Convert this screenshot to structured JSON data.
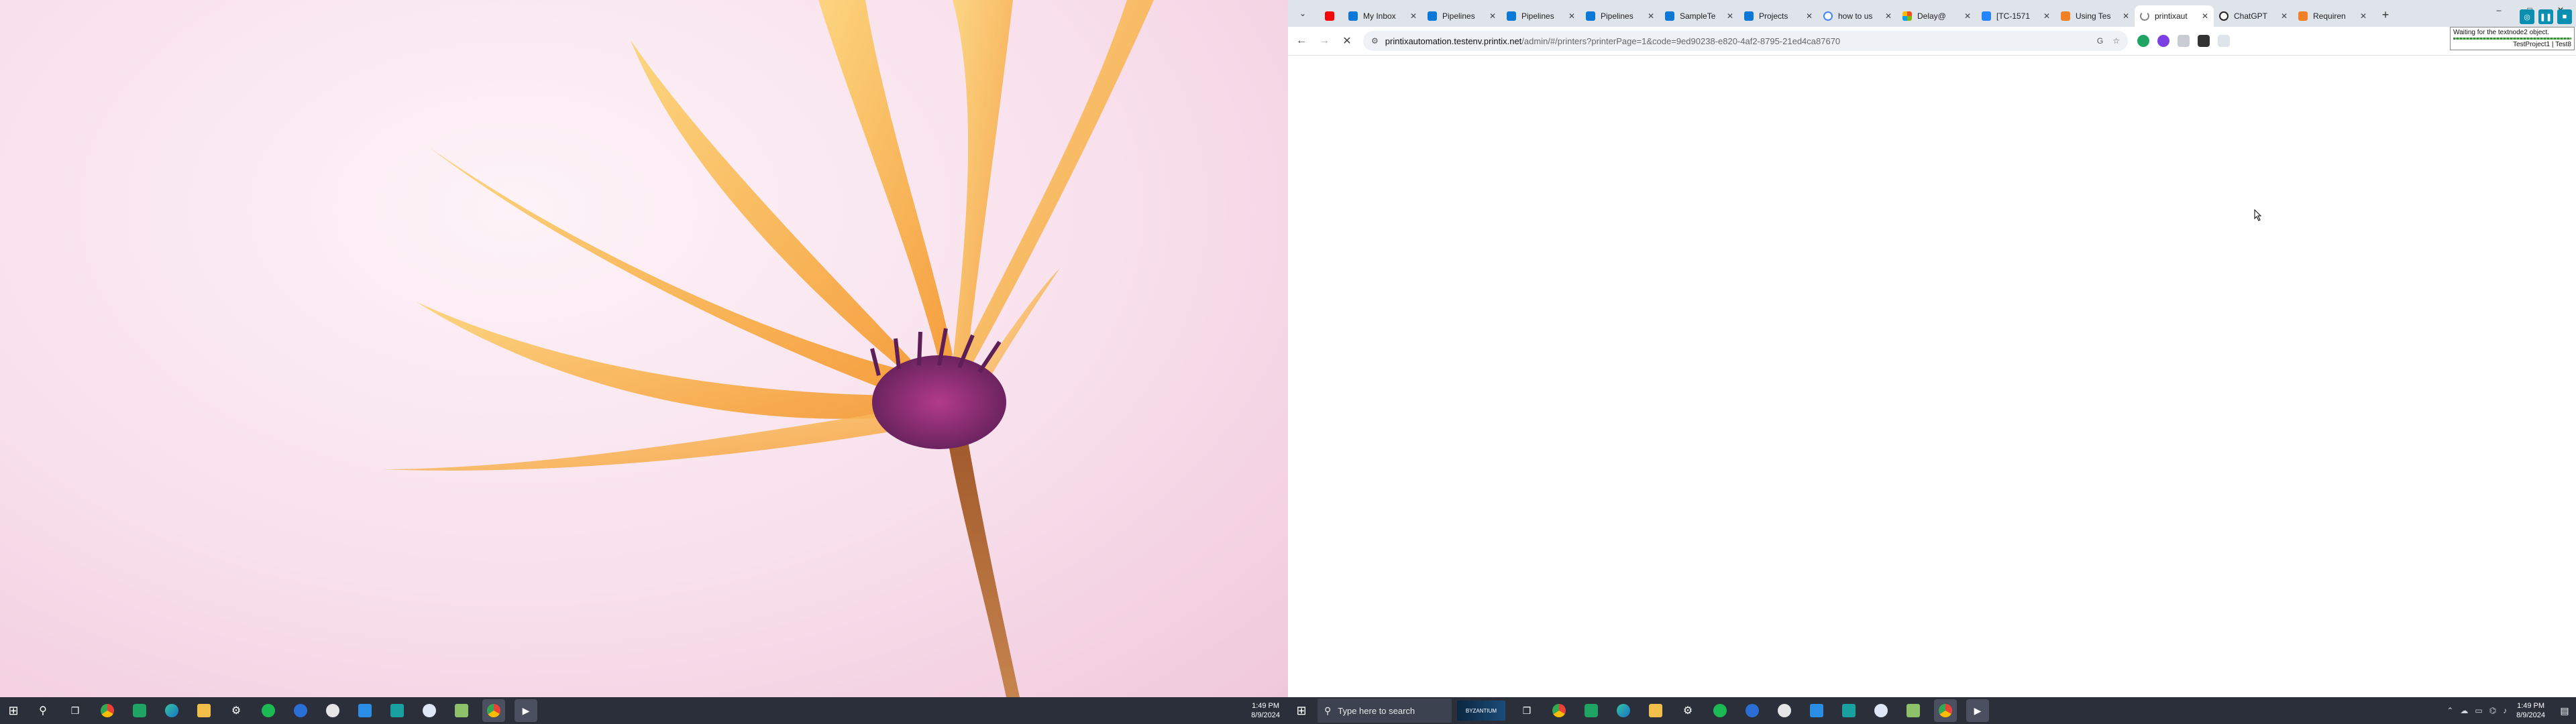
{
  "left_screen": {
    "taskbar": {
      "icons": [
        "windows-start-icon",
        "search-icon",
        "task-view-icon",
        "chrome-icon",
        "app-green-icon",
        "edge-icon",
        "file-explorer-icon",
        "settings-icon",
        "spotify-icon",
        "app-shield-icon",
        "github-icon",
        "vscode-icon",
        "app-teal-icon",
        "app-chat-icon",
        "app-sheet-icon",
        "chrome-active-icon",
        "media-player-icon"
      ],
      "time": "1:49 PM",
      "date": "8/9/2024"
    }
  },
  "browser": {
    "tabs": [
      {
        "label": "",
        "icon": "youtube-icon",
        "pinned": true
      },
      {
        "label": "My Inbox",
        "icon": "azure-devops-icon"
      },
      {
        "label": "Pipelines",
        "icon": "azure-devops-icon"
      },
      {
        "label": "Pipelines",
        "icon": "azure-devops-icon"
      },
      {
        "label": "Pipelines",
        "icon": "azure-devops-icon"
      },
      {
        "label": "SampleTe",
        "icon": "azure-devops-icon"
      },
      {
        "label": "Projects",
        "icon": "azure-devops-icon"
      },
      {
        "label": "how to us",
        "icon": "google-icon"
      },
      {
        "label": "Delay@",
        "icon": "office-icon"
      },
      {
        "label": "[TC-1571",
        "icon": "jira-icon"
      },
      {
        "label": "Using Tes",
        "icon": "stackoverflow-icon"
      },
      {
        "label": "printixaut",
        "icon": "loading-icon",
        "active": true
      },
      {
        "label": "ChatGPT",
        "icon": "chatgpt-icon"
      },
      {
        "label": "Requiren",
        "icon": "stackoverflow-icon"
      }
    ],
    "new_tab": "+",
    "url_host": "printixautomation.testenv.printix.net",
    "url_path": "/admin/#/printers?printerPage=1&code=9ed90238-e820-4af2-8795-21ed4ca87670",
    "omnibox_right": "G",
    "window_controls": [
      "–",
      "□",
      "✕"
    ]
  },
  "right_screen": {
    "taskbar": {
      "search_placeholder": "Type here to search",
      "promo_text": "BYZANTIUM",
      "icons": [
        "task-view-icon",
        "chrome-icon",
        "app-green-icon",
        "edge-icon",
        "file-explorer-icon",
        "settings-icon",
        "spotify-icon",
        "app-shield-icon",
        "github-icon",
        "vscode-icon",
        "app-teal-icon",
        "app-chat-icon",
        "app-sheet-icon",
        "chrome-active-icon",
        "media-player-icon"
      ],
      "time": "1:49 PM",
      "date": "8/9/2024"
    }
  },
  "agent_widget": {
    "status_text": "Waiting for the textnode2 object.",
    "project_text": "TestProject1 | Test8"
  },
  "colors": {
    "taskbar": "#2a2f3a",
    "tabstrip": "#dfe3ea",
    "petals": "#f7a640",
    "flower_center": "#7a2a6a"
  }
}
